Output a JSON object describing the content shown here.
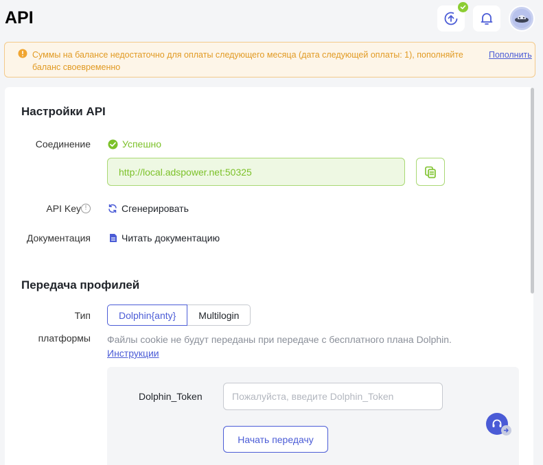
{
  "header": {
    "title": "API"
  },
  "alert": {
    "text": "Суммы на балансе недостаточно для оплаты следующего месяца (дата следующей оплаты: 1), пополняйте баланс своевременно",
    "link": "Пополнить"
  },
  "api_settings": {
    "title": "Настройки API",
    "connection_label": "Соединение",
    "connection_status": "Успешно",
    "url": "http://local.adspower.net:50325",
    "api_key_label": "API Key",
    "generate_label": "Сгенерировать",
    "docs_label": "Документация",
    "docs_link": "Читать документацию"
  },
  "profile_transfer": {
    "title": "Передача профилей",
    "platform_label_1": "Тип",
    "platform_label_2": "платформы",
    "options": [
      "Dolphin{anty}",
      "Multilogin"
    ],
    "hint_text": "Файлы cookie не будут переданы при передаче с бесплатного плана Dolphin.",
    "hint_link": "Инструкции",
    "token_label": "Dolphin_Token",
    "token_placeholder": "Пожалуйста, введите Dolphin_Token",
    "token_value": "",
    "start_button": "Начать передачу"
  },
  "colors": {
    "accent": "#4a5bd6",
    "success": "#7cc129",
    "warning": "#e19a23"
  }
}
